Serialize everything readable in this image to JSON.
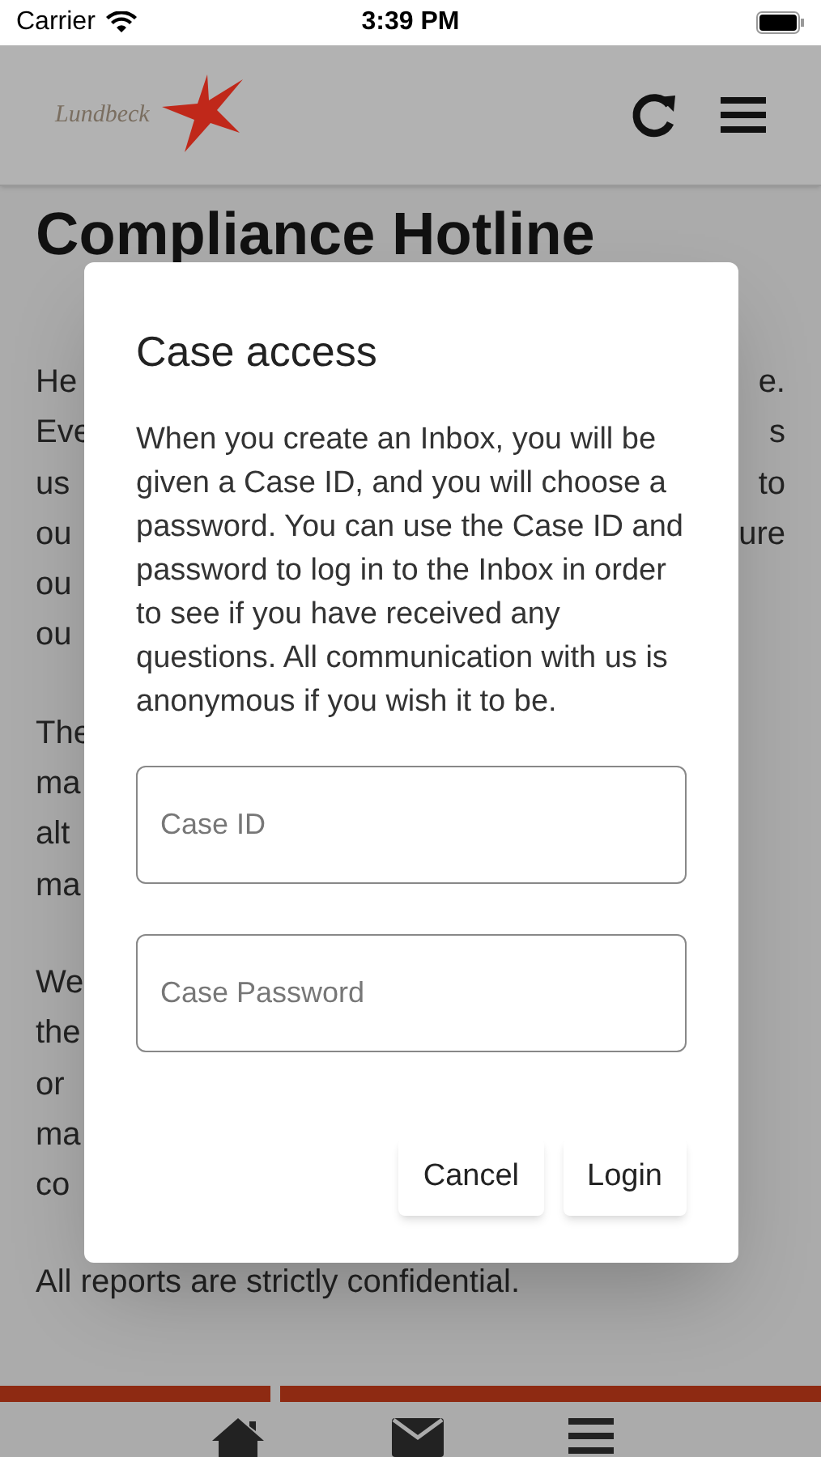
{
  "status_bar": {
    "carrier": "Carrier",
    "time": "3:39 PM"
  },
  "header": {
    "logo_text": "Lundbeck"
  },
  "page": {
    "title": "Compliance Hotline",
    "paragraphs": [
      [
        {
          "left": "He",
          "right": "e."
        },
        {
          "left": "Eve",
          "right": "s"
        },
        {
          "left": "us",
          "right": "to"
        },
        {
          "left": "ou",
          "right": "ure"
        },
        {
          "left": "ou"
        },
        {
          "left": "ou"
        }
      ],
      [
        {
          "left": "The"
        },
        {
          "left": "ma"
        },
        {
          "left": "alt"
        },
        {
          "left": "ma"
        }
      ],
      [
        {
          "left": "We"
        },
        {
          "left": "the"
        },
        {
          "left": "or"
        },
        {
          "left": "ma"
        },
        {
          "left": "co"
        }
      ],
      [
        {
          "left": "All reports are strictly confidential."
        }
      ]
    ]
  },
  "dialog": {
    "title": "Case access",
    "text": "When you create an Inbox, you will be given a Case ID, and you will choose a password. You can use the Case ID and password to log in to the Inbox in order to see if you have received any questions. All communication with us is anonymous if you wish it to be.",
    "fields": [
      {
        "placeholder": "Case ID"
      },
      {
        "placeholder": "Case Password"
      }
    ],
    "buttons": [
      "Cancel",
      "Login"
    ]
  }
}
